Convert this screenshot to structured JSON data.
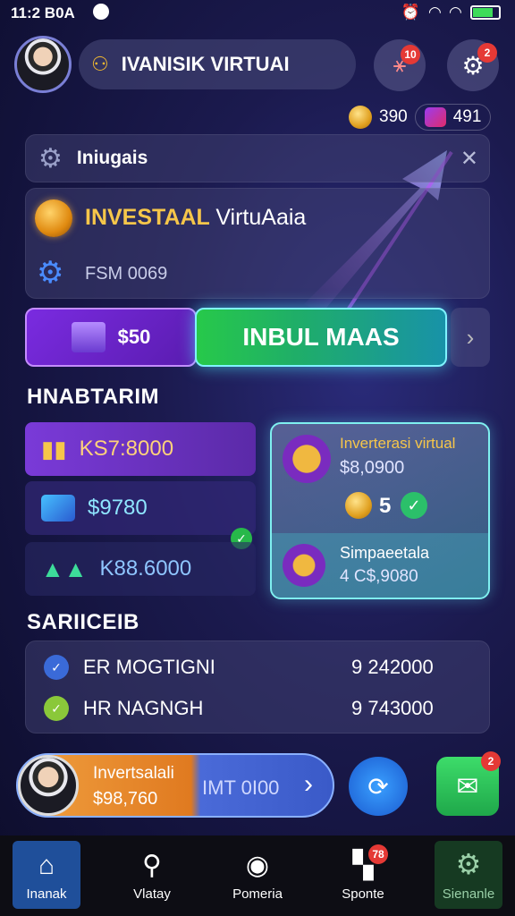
{
  "status_bar": {
    "time": "11:2 B0A"
  },
  "header": {
    "username": "IVANISIK VIRTUAI",
    "notif_badge_1": "10",
    "notif_badge_2": "2"
  },
  "currency": {
    "coins": "390",
    "gems": "491"
  },
  "notification": {
    "title": "Iniugais"
  },
  "investment": {
    "title": "INVESTAAL",
    "title_suffix": "VirtuAaia",
    "subtitle": "FSM 0069"
  },
  "cta": {
    "amount": "$50",
    "main_label": "INBUL MAAS"
  },
  "stats_section": {
    "heading": "HNABTARIM",
    "items": [
      {
        "value": "KS7:8000"
      },
      {
        "value": "$9780"
      },
      {
        "value": "K88.6000"
      }
    ]
  },
  "feature_card": {
    "title": "Inverterasi virtual",
    "value": "$8,0900",
    "rating": "5",
    "sub_title": "Simpaeetala",
    "sub_value": "4 C$,9080"
  },
  "services": {
    "heading": "SARIICEIB",
    "rows": [
      {
        "label": "ER MOGTIGNI",
        "value": "9 242000"
      },
      {
        "label": "HR NAGNGH",
        "value": "9 743000"
      }
    ]
  },
  "bottom_promo": {
    "title": "Invertsalali",
    "amount": "$98,760",
    "action": "IMT 0I00",
    "mail_badge": "2"
  },
  "tabs": [
    {
      "label": "Inanak",
      "active": true
    },
    {
      "label": "Vlatay"
    },
    {
      "label": "Pomeria"
    },
    {
      "label": "Sponte",
      "badge": "78"
    },
    {
      "label": "Sienanle"
    }
  ],
  "colors": {
    "accent_green": "#27c94a",
    "accent_purple": "#7a2be0",
    "accent_cyan": "#7ff3ff",
    "badge_red": "#e53935"
  }
}
